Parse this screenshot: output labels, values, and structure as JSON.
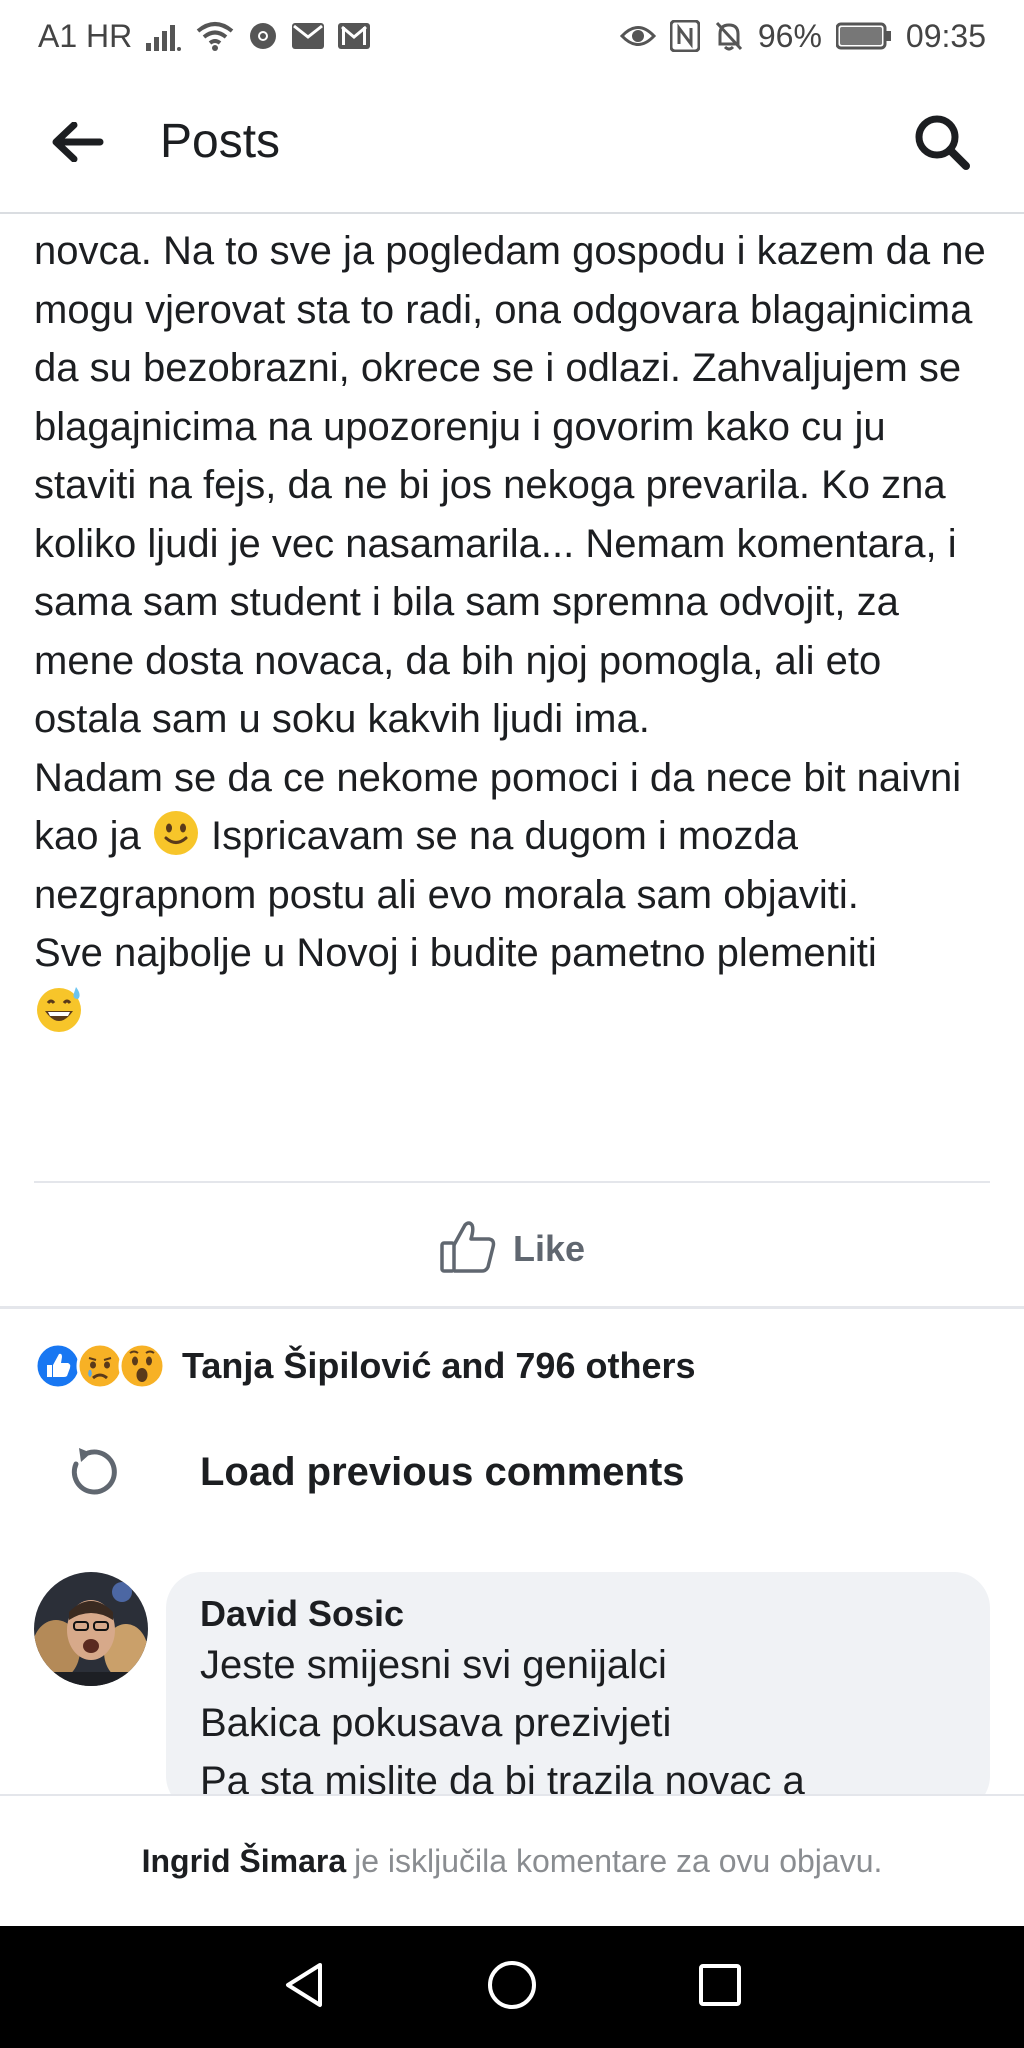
{
  "status_bar": {
    "carrier": "A1 HR",
    "battery": "96%",
    "time": "09:35"
  },
  "app_bar": {
    "title": "Posts"
  },
  "post": {
    "paragraphs": [
      "novca. Na to sve ja pogledam gospodu i kazem da ne mogu vjerovat sta to radi, ona odgovara blagajnicima da su bezobrazni, okrece se i odlazi. Zahvaljujem se blagajnicima na upozorenju i govorim kako cu ju staviti na fejs, da ne bi jos nekoga prevarila. Ko zna koliko ljudi je vec nasamarila... Nemam komentara, i sama sam student i bila sam spremna odvojit, za mene dosta novaca, da bih njoj pomogla, ali eto ostala sam u soku kakvih ljudi ima.",
      "Nadam se da ce nekome pomoci i da nece bit naivni kao ja",
      "Ispricavam se na dugom i mozda nezgrapnom postu ali evo morala sam objaviti.",
      "Sve najbolje u Novoj i budite pametno plemeniti"
    ],
    "emoji_1": "slightly-smiling-face",
    "emoji_2": "grinning-face-with-sweat"
  },
  "actions": {
    "like_label": "Like"
  },
  "reactions": {
    "icons": [
      "like",
      "sad",
      "wow"
    ],
    "summary": "Tanja Šipilović and 796 others"
  },
  "comments": {
    "load_previous_label": "Load previous comments",
    "items": [
      {
        "author": "David Sosic",
        "lines": [
          "Jeste smijesni svi genijalci",
          "Bakica pokusava prezivjeti",
          "Pa sta mislite da bi trazila novac a"
        ]
      }
    ]
  },
  "footer": {
    "owner_name": "Ingrid Šimara",
    "comments_off_text": "je isključila komentare za ovu objavu."
  },
  "colors": {
    "like_blue": "#1877f2",
    "reaction_yellow": "#f7b125",
    "secondary_text": "#606770",
    "bubble_bg": "#f0f2f5"
  }
}
